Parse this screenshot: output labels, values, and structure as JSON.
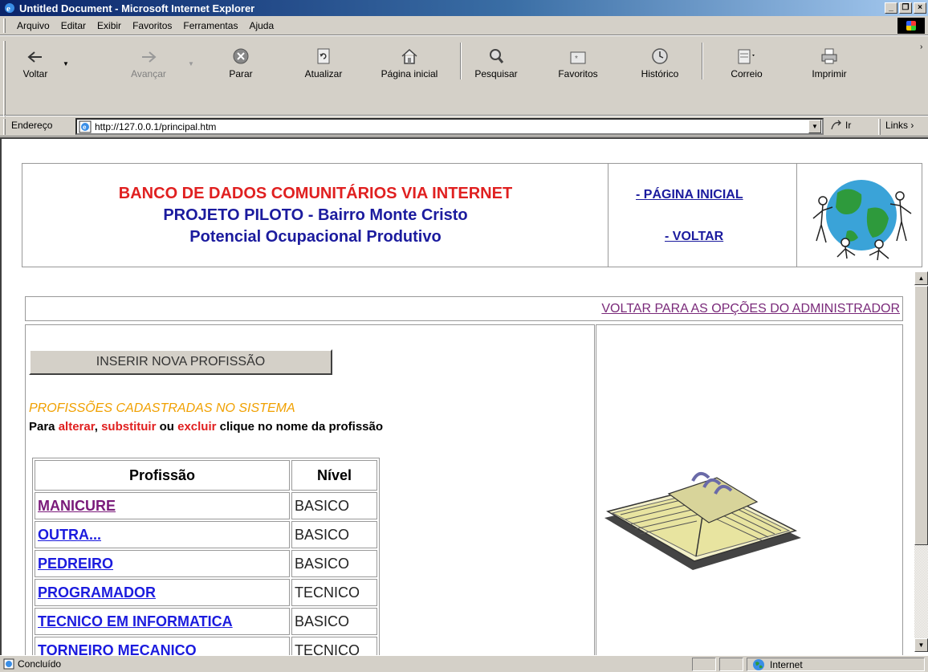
{
  "window": {
    "title": "Untitled Document - Microsoft Internet Explorer",
    "minimize": "_",
    "maximize": "❐",
    "close": "×"
  },
  "menu": {
    "items": [
      "Arquivo",
      "Editar",
      "Exibir",
      "Favoritos",
      "Ferramentas",
      "Ajuda"
    ]
  },
  "toolbar": {
    "back": "Voltar",
    "forward": "Avançar",
    "stop": "Parar",
    "refresh": "Atualizar",
    "home": "Página inicial",
    "search": "Pesquisar",
    "favorites": "Favoritos",
    "history": "Histórico",
    "mail": "Correio",
    "print": "Imprimir"
  },
  "address": {
    "label": "Endereço",
    "url": "http://127.0.0.1/principal.htm",
    "go": "Ir",
    "links": "Links"
  },
  "header": {
    "line1": "BANCO DE DADOS COMUNITÁRIOS VIA INTERNET",
    "line2": "PROJETO PILOTO - Bairro Monte Cristo",
    "line3": "Potencial Ocupacional Produtivo",
    "link_home": "- PÁGINA INICIAL",
    "link_back": "- VOLTAR"
  },
  "admin_link": "VOLTAR PARA AS OPÇÕES DO ADMINISTRADOR",
  "insert_button": "INSERIR NOVA PROFISSÃO",
  "section_title": "PROFISSÕES CADASTRADAS NO SISTEMA",
  "instructions": {
    "part1": "Para ",
    "alterar": "alterar",
    "part2": ", ",
    "substituir": "substituir",
    "part3": " ou ",
    "excluir": "excluir",
    "part4": " clique no nome da profissão"
  },
  "table": {
    "headers": [
      "Profissão",
      "Nível"
    ],
    "rows": [
      {
        "name": "MANICURE",
        "level": "BASICO"
      },
      {
        "name": "OUTRA...",
        "level": "BASICO"
      },
      {
        "name": "PEDREIRO",
        "level": "BASICO"
      },
      {
        "name": "PROGRAMADOR",
        "level": "TECNICO"
      },
      {
        "name": "TECNICO EM INFORMATICA",
        "level": "BASICO"
      },
      {
        "name": "TORNEIRO MECANICO",
        "level": "TECNICO"
      }
    ]
  },
  "status": {
    "text": "Concluído",
    "zone": "Internet"
  }
}
